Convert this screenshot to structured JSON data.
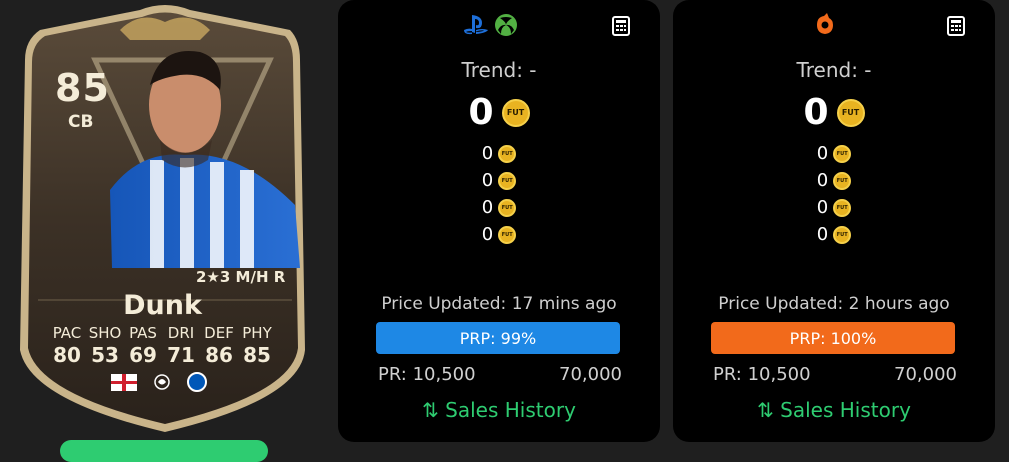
{
  "card": {
    "rating": "85",
    "position": "CB",
    "name": "Dunk",
    "skills": "2★3 M/H R",
    "stats": [
      {
        "label": "PAC",
        "value": "80"
      },
      {
        "label": "SHO",
        "value": "53"
      },
      {
        "label": "PAS",
        "value": "69"
      },
      {
        "label": "DRI",
        "value": "71"
      },
      {
        "label": "DEF",
        "value": "86"
      },
      {
        "label": "PHY",
        "value": "85"
      }
    ]
  },
  "console_panel": {
    "trend": "Trend: -",
    "main_price": "0",
    "sub_prices": [
      "0",
      "0",
      "0",
      "0"
    ],
    "coin_label": "FUT",
    "updated": "Price Updated: 17 mins ago",
    "prp": "PRP: 99%",
    "prp_percent": 99,
    "range_min": "PR: 10,500",
    "range_max": "70,000",
    "sales_history": "⇅ Sales History",
    "accent": "#1e88e5"
  },
  "pc_panel": {
    "trend": "Trend: -",
    "main_price": "0",
    "sub_prices": [
      "0",
      "0",
      "0",
      "0"
    ],
    "coin_label": "FUT",
    "updated": "Price Updated: 2 hours ago",
    "prp": "PRP: 100%",
    "prp_percent": 100,
    "range_min": "PR: 10,500",
    "range_max": "70,000",
    "sales_history": "⇅ Sales History",
    "accent": "#f26a1b"
  },
  "icons": {
    "console": [
      "playstation-icon",
      "xbox-icon"
    ],
    "pc": [
      "origin-icon"
    ],
    "calculator": "calculator-icon"
  },
  "colors": {
    "sales_green": "#2ecc71",
    "coin_gold": "#e8b321",
    "panel_bg": "#000000"
  }
}
